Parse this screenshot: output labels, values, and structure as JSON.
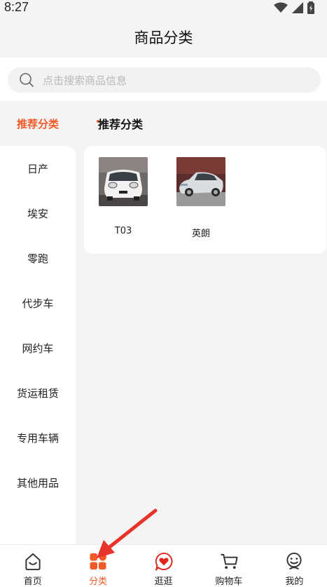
{
  "status": {
    "time": "8:27"
  },
  "header": {
    "title": "商品分类"
  },
  "search": {
    "placeholder": "点击搜索商品信息"
  },
  "sidebar": {
    "active": "推荐分类",
    "items": [
      "日产",
      "埃安",
      "零跑",
      "代步车",
      "网约车",
      "货运租赁",
      "专用车辆",
      "其他用品"
    ]
  },
  "main": {
    "section_title": "推荐分类",
    "products": [
      {
        "label": "T03",
        "image": "white-compact-car"
      },
      {
        "label": "英朗",
        "image": "silver-sedan-car"
      }
    ]
  },
  "tabbar": {
    "tabs": [
      {
        "label": "首页",
        "icon": "home-icon"
      },
      {
        "label": "分类",
        "icon": "category-icon"
      },
      {
        "label": "逛逛",
        "icon": "heart-chat-icon"
      },
      {
        "label": "购物车",
        "icon": "cart-icon"
      },
      {
        "label": "我的",
        "icon": "profile-icon"
      }
    ],
    "active_index": 1
  },
  "colors": {
    "accent": "#f05a28",
    "background": "#f4f4f4"
  }
}
